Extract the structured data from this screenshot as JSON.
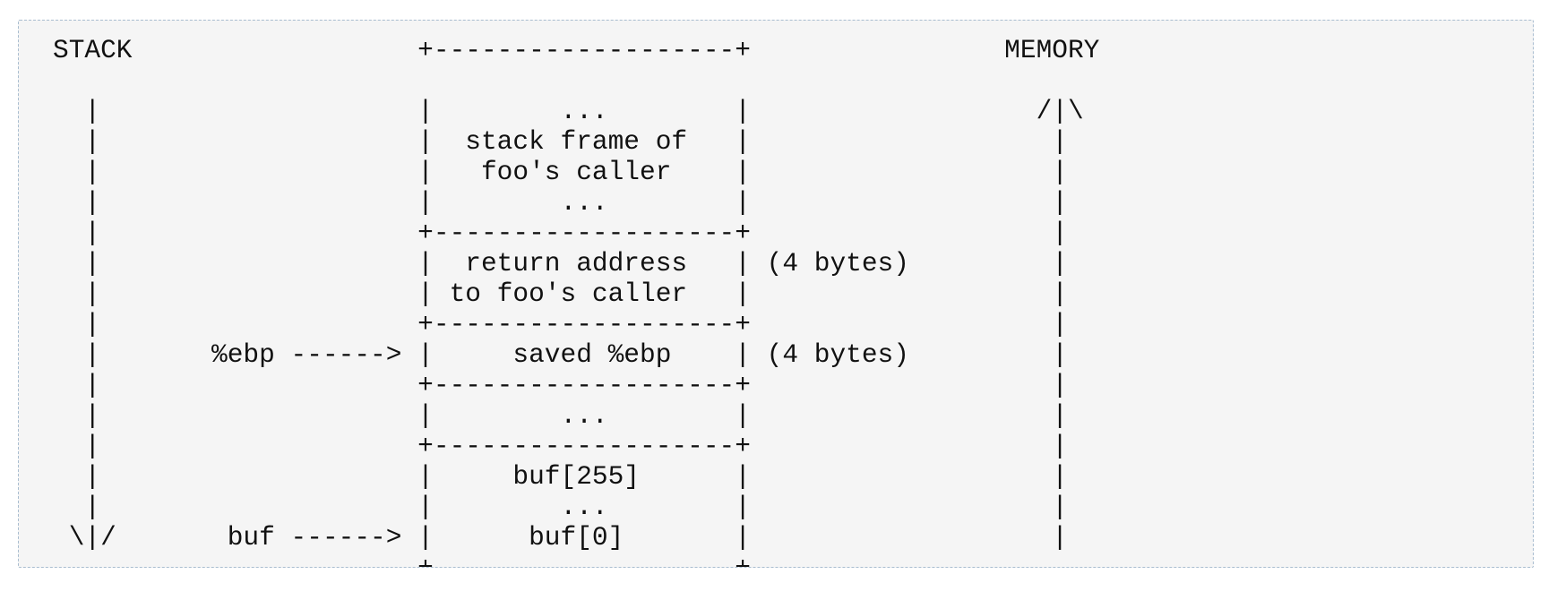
{
  "diagram": {
    "lines": [
      "STACK                  +-------------------+                MEMORY",
      "",
      "  |                    |        ...        |                  /|\\",
      "  |                    |  stack frame of   |                   |",
      "  |                    |   foo's caller    |                   |",
      "  |                    |        ...        |                   |",
      "  |                    +-------------------+                   |",
      "  |                    |  return address   | (4 bytes)         |",
      "  |                    | to foo's caller   |                   |",
      "  |                    +-------------------+                   |",
      "  |       %ebp ------> |     saved %ebp    | (4 bytes)         |",
      "  |                    +-------------------+                   |",
      "  |                    |        ...        |                   |",
      "  |                    +-------------------+                   |",
      "  |                    |     buf[255]      |                   |",
      "  |                    |        ...        |                   |",
      " \\|/       buf ------> |      buf[0]       |                   |",
      "                       +-------------------+"
    ]
  }
}
